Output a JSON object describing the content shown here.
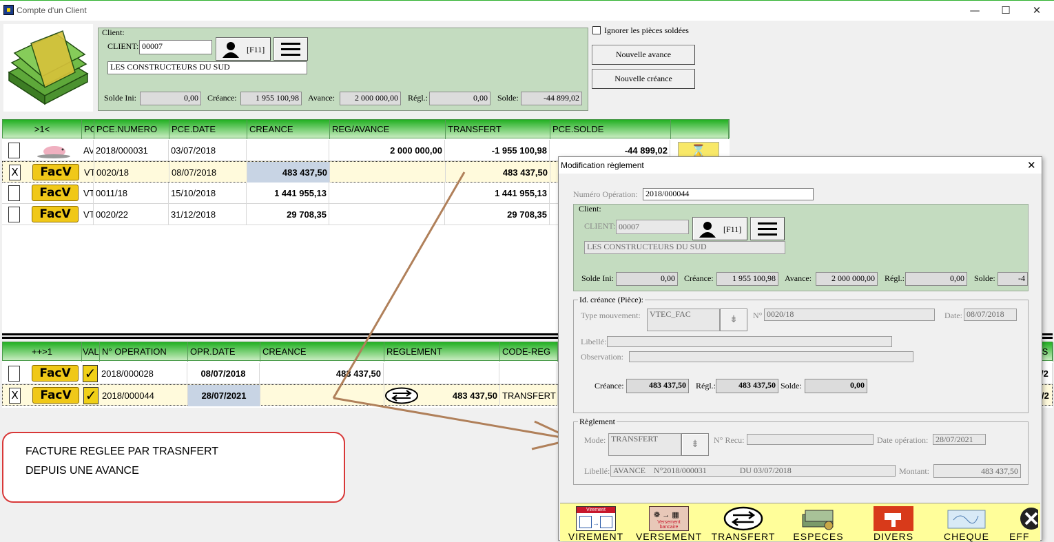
{
  "window": {
    "title": "Compte d'un Client",
    "minimize": "—",
    "maximize": "☐",
    "close": "✕"
  },
  "client_panel": {
    "group_label": "Client:",
    "client_label": "CLIENT:",
    "client_code": "00007",
    "f11_label": "[F11]",
    "client_name": "LES CONSTRUCTEURS DU SUD",
    "totals": [
      {
        "label": "Solde Ini:",
        "value": "0,00"
      },
      {
        "label": "Créance:",
        "value": "1 955 100,98"
      },
      {
        "label": "Avance:",
        "value": "2 000 000,00"
      },
      {
        "label": "Régl.:",
        "value": "0,00"
      },
      {
        "label": "Solde:",
        "value": "-44 899,02"
      }
    ]
  },
  "options": {
    "ignore_label": "Ignorer les pièces soldées",
    "ignore_checked": false,
    "new_advance": "Nouvelle avance",
    "new_claim": "Nouvelle créance"
  },
  "pieces_grid": {
    "headers": [
      ">1<",
      "PC",
      "PCE.NUMERO",
      "PCE.DATE",
      "CREANCE",
      "REG/AVANCE",
      "TRANSFERT",
      "PCE.SOLDE",
      ""
    ],
    "rows": [
      {
        "checked": "",
        "kind": "",
        "pc": "AV",
        "numero": "2018/000031",
        "date": "03/07/2018",
        "creance": "",
        "reg": "2 000 000,00",
        "transfert": "-1 955 100,98",
        "solde": "-44 899,02",
        "selected": false
      },
      {
        "checked": "X",
        "kind": "FacV",
        "pc": "VT",
        "numero": "0020/18",
        "date": "08/07/2018",
        "creance": "483 437,50",
        "reg": "",
        "transfert": "483 437,50",
        "solde": "",
        "selected": true
      },
      {
        "checked": "",
        "kind": "FacV",
        "pc": "VT",
        "numero": "0011/18",
        "date": "15/10/2018",
        "creance": "1 441 955,13",
        "reg": "",
        "transfert": "1 441 955,13",
        "solde": "",
        "selected": false
      },
      {
        "checked": "",
        "kind": "FacV",
        "pc": "VT",
        "numero": "0020/22",
        "date": "31/12/2018",
        "creance": "29 708,35",
        "reg": "",
        "transfert": "29 708,35",
        "solde": "",
        "selected": false
      }
    ]
  },
  "ops_grid": {
    "headers": [
      "++>1",
      "VAL",
      "N° OPERATION",
      "OPR.DATE",
      "CREANCE",
      "REGLEMENT",
      "CODE-REG",
      "PS"
    ],
    "rows": [
      {
        "checked": "",
        "kind": "FacV",
        "val": "✓",
        "numero": "2018/000028",
        "date": "08/07/2018",
        "creance": "483 437,50",
        "reglement": "",
        "code": "",
        "tail": "/2"
      },
      {
        "checked": "X",
        "kind": "FacV",
        "val": "✓",
        "numero": "2018/000044",
        "date": "28/07/2021",
        "creance": "",
        "reglement": "483 437,50",
        "code": "TRANSFERT",
        "tail": "/2"
      }
    ]
  },
  "annotation": {
    "line1": "FACTURE REGLEE PAR TRASNFERT",
    "line2": "DEPUIS UNE AVANCE",
    "color": "#d83838"
  },
  "dialog": {
    "title": "Modification règlement",
    "close": "✕",
    "op_label": "Numéro Opération:",
    "op_value": "2018/000044",
    "client_group": "Client:",
    "client_label": "CLIENT:",
    "client_code": "00007",
    "f11_label": "[F11]",
    "client_name": "LES CONSTRUCTEURS DU SUD",
    "totals": [
      {
        "label": "Solde Ini:",
        "value": "0,00"
      },
      {
        "label": "Créance:",
        "value": "1 955 100,98"
      },
      {
        "label": "Avance:",
        "value": "2 000 000,00"
      },
      {
        "label": "Régl.:",
        "value": "0,00"
      },
      {
        "label": "Solde:",
        "value": "-4"
      }
    ],
    "piece_group": "Id. créance (Pièce):",
    "type_label": "Type mouvement:",
    "type_value": "VTEC_FAC",
    "no_label": "N°",
    "no_value": "0020/18",
    "date_label": "Date:",
    "date_value": "08/07/2018",
    "libelle_label": "Libellé:",
    "libelle_value": "",
    "obs_label": "Observation:",
    "obs_value": "",
    "creance_label": "Créance:",
    "creance_value": "483 437,50",
    "regl_label": "Régl.:",
    "regl_value": "483 437,50",
    "solde_label": "Solde:",
    "solde_value": "0,00",
    "reglement_group": "Règlement",
    "mode_label": "Mode:",
    "mode_value": "TRANSFERT",
    "recu_label": "N° Recu:",
    "recu_value": "",
    "dateop_label": "Date opération:",
    "dateop_value": "28/07/2021",
    "lib2_label": "Libellé:",
    "lib2_value": "AVANCE    N°2018/000031                DU 03/07/2018",
    "montant_label": "Montant:",
    "montant_value": "483 437,50",
    "tools": [
      {
        "label": "VIREMENT",
        "icon": "bank-transfer-icon",
        "caption": "Virement Bancaire"
      },
      {
        "label": "VERSEMENT",
        "icon": "bank-deposit-icon",
        "caption": "Versement bancaire"
      },
      {
        "label": "TRANSFERT",
        "icon": "transfer-icon",
        "caption": ""
      },
      {
        "label": "ESPECES",
        "icon": "cash-icon",
        "caption": ""
      },
      {
        "label": "DIVERS",
        "icon": "misc-icon",
        "caption": ""
      },
      {
        "label": "CHEQUE",
        "icon": "cheque-icon",
        "caption": ""
      },
      {
        "label": "EFF",
        "icon": "effect-icon",
        "caption": ""
      }
    ]
  },
  "colors": {
    "grid_header": "#22b022",
    "client_bg": "#c4dcc0",
    "toolbar_bg": "#fffe9a",
    "arrow": "#b0805a"
  }
}
